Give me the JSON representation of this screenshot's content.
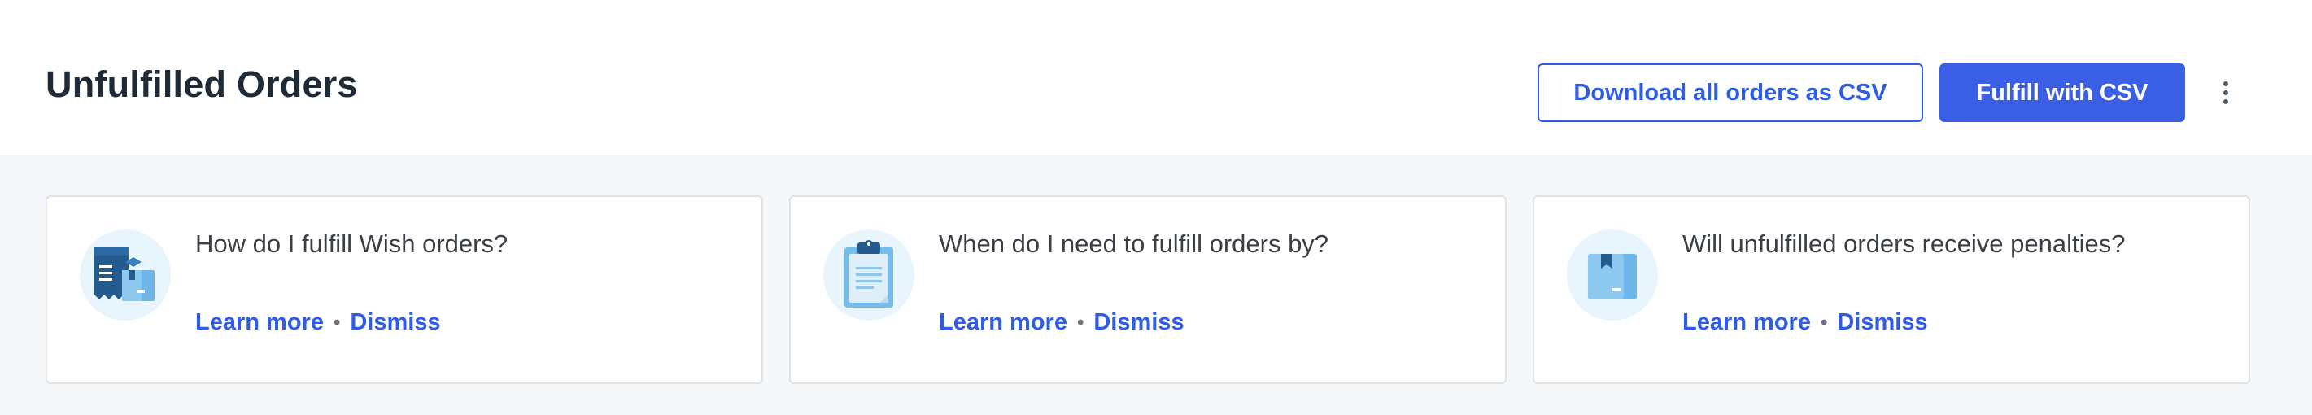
{
  "header": {
    "title": "Unfulfilled Orders",
    "download_label": "Download all orders as CSV",
    "fulfill_label": "Fulfill with CSV",
    "more_icon": "kebab-menu-icon"
  },
  "cards": [
    {
      "question": "How do I fulfill Wish orders?",
      "learn_more": "Learn more",
      "separator": "•",
      "dismiss": "Dismiss",
      "icon": "shipping-documents-icon"
    },
    {
      "question": "When do I need to fulfill orders by?",
      "learn_more": "Learn more",
      "separator": "•",
      "dismiss": "Dismiss",
      "icon": "clipboard-icon"
    },
    {
      "question": "Will unfulfilled orders receive penalties?",
      "learn_more": "Learn more",
      "separator": "•",
      "dismiss": "Dismiss",
      "icon": "package-box-icon"
    }
  ],
  "colors": {
    "accent": "#2f5ce6",
    "primary_button": "#3a5fe5",
    "title_text": "#1f2a37",
    "body_background": "#f5f7f8",
    "icon_circle": "#e8f5fc"
  }
}
